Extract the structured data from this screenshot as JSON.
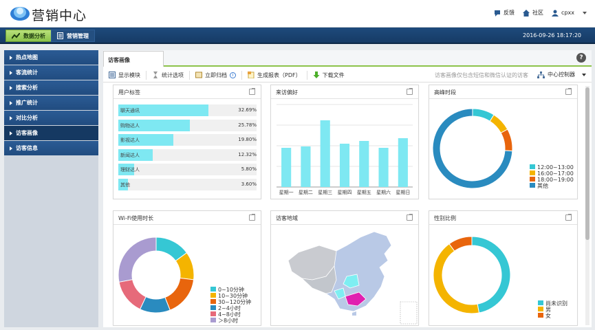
{
  "app": {
    "title": "营销中心"
  },
  "header": {
    "links": [
      {
        "label": "反馈",
        "icon": "feedback-icon"
      },
      {
        "label": "社区",
        "icon": "home-icon"
      },
      {
        "label": "cpxx",
        "icon": "user-icon"
      }
    ]
  },
  "nav": {
    "tabs": [
      {
        "label": "数据分析",
        "icon": "chart-icon",
        "active": true
      },
      {
        "label": "营销管理",
        "icon": "document-icon",
        "active": false
      }
    ],
    "datetime": "2016-09-26 18:17:20"
  },
  "sidebar": {
    "items": [
      {
        "label": "热点地图"
      },
      {
        "label": "客流统计"
      },
      {
        "label": "搜索分析"
      },
      {
        "label": "推广统计"
      },
      {
        "label": "对比分析"
      },
      {
        "label": "访客画像",
        "active": true
      },
      {
        "label": "访客信息"
      }
    ]
  },
  "page": {
    "tab": "访客画像"
  },
  "toolbar": {
    "items": [
      {
        "label": "显示模块",
        "icon": "module-icon"
      },
      {
        "label": "统计选项",
        "icon": "hourglass-icon"
      },
      {
        "label": "立即归档",
        "icon": "archive-icon"
      },
      {
        "label": "生成报表（PDF）",
        "icon": "report-icon"
      },
      {
        "label": "下载文件",
        "icon": "download-icon"
      }
    ],
    "note": "访客画像仅包含短信和微信认证的访客",
    "control": "中心控制器"
  },
  "panels": {
    "user_tags": {
      "title": "用户标签",
      "rows": [
        {
          "label": "聊天通讯",
          "value": "32.69%",
          "pct": 32.69
        },
        {
          "label": "购物达人",
          "value": "25.78%",
          "pct": 25.78
        },
        {
          "label": "影视达人",
          "value": "19.80%",
          "pct": 19.8
        },
        {
          "label": "新闻达人",
          "value": "12.32%",
          "pct": 12.32
        },
        {
          "label": "理财达人",
          "value": "5.80%",
          "pct": 5.8
        },
        {
          "label": "其他",
          "value": "3.60%",
          "pct": 3.6
        }
      ]
    },
    "visit_pref": {
      "title": "来访偏好"
    },
    "peak": {
      "title": "高峰时段"
    },
    "wifi": {
      "title": "Wi-Fi使用时长"
    },
    "region": {
      "title": "访客地域"
    },
    "gender": {
      "title": "性别比例"
    }
  },
  "chart_data": [
    {
      "type": "bar",
      "categories": [
        "星期一",
        "星期二",
        "星期三",
        "星期四",
        "星期五",
        "星期六",
        "星期日"
      ],
      "values": [
        57,
        59,
        97,
        63,
        67,
        57,
        71
      ],
      "ylim": [
        0,
        120
      ],
      "color": "#7ee8f2"
    },
    {
      "type": "pie",
      "donut": true,
      "labels": [
        "12:00~13:00",
        "16:00~17:00",
        "18:00~19:00",
        "其他"
      ],
      "values": [
        9,
        8,
        9,
        74
      ],
      "colors": [
        "#35c7d4",
        "#f4b400",
        "#e8650d",
        "#2a8bbf"
      ]
    },
    {
      "type": "pie",
      "donut": true,
      "labels": [
        "0~10分钟",
        "10~30分钟",
        "30~120分钟",
        "2~4小时",
        "4~8小时",
        "＞8小时"
      ],
      "values": [
        15,
        12,
        17,
        13,
        15,
        28
      ],
      "colors": [
        "#35c7d4",
        "#f4b400",
        "#e8650d",
        "#2a8bbf",
        "#e66a7a",
        "#a99bd0"
      ]
    },
    {
      "type": "pie",
      "donut": true,
      "labels": [
        "尚未识别",
        "男",
        "女"
      ],
      "values": [
        47,
        43,
        10
      ],
      "colors": [
        "#35c7d4",
        "#f4b400",
        "#e8650d"
      ]
    }
  ]
}
